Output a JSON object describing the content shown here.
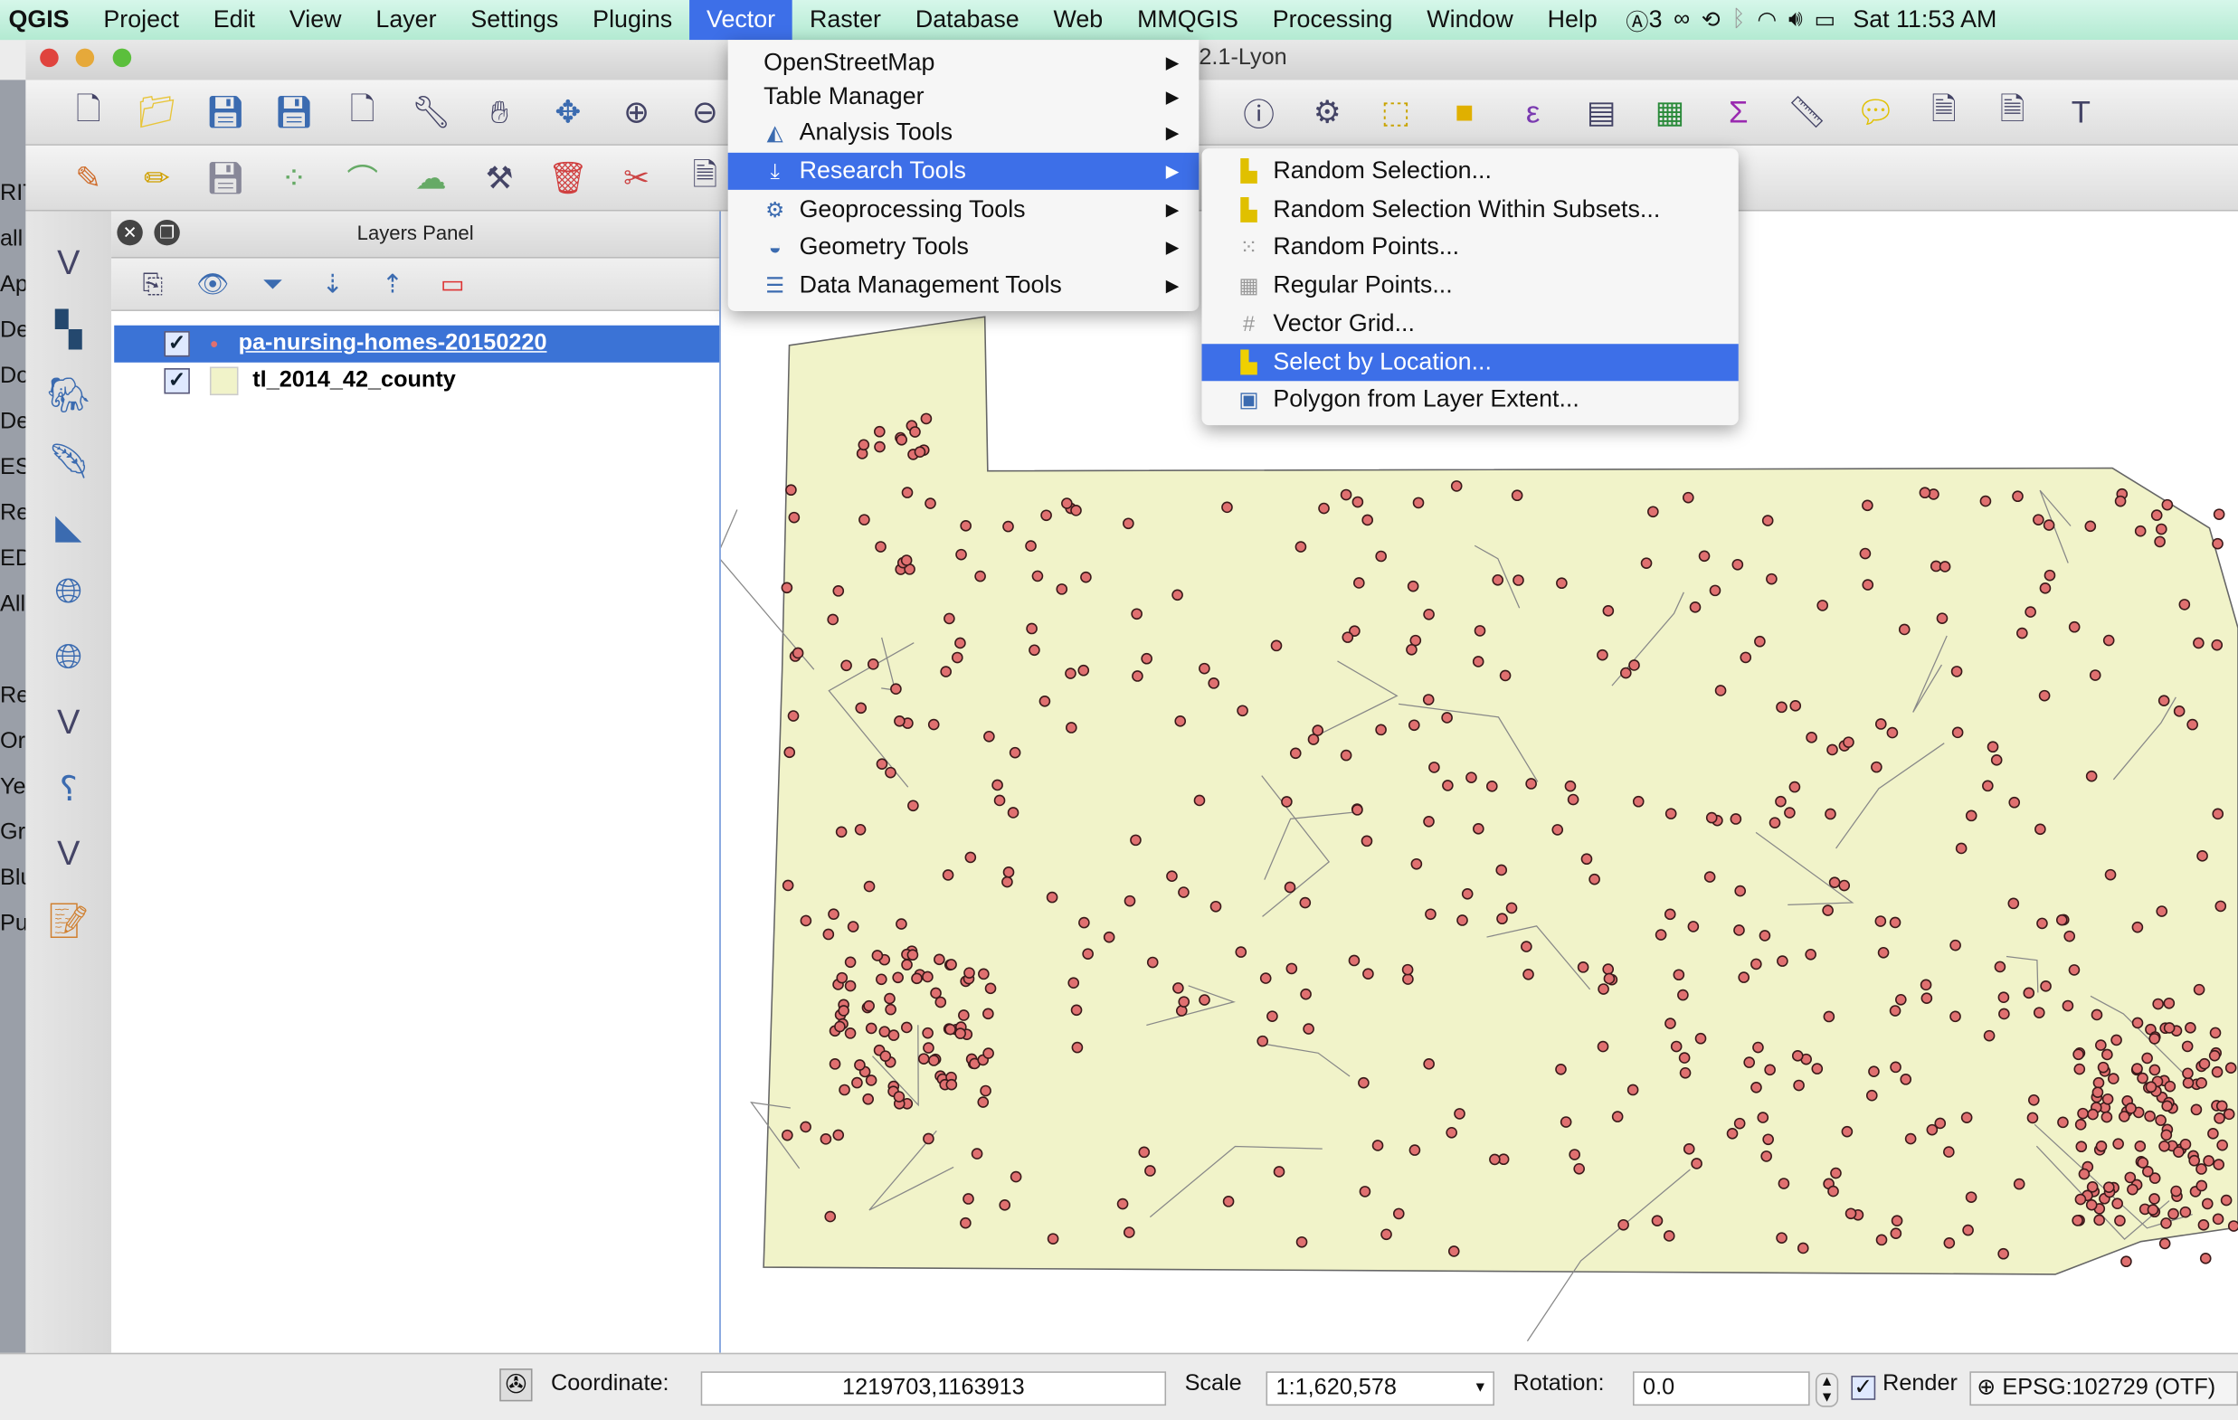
{
  "menubar": {
    "app": "QGIS",
    "items": [
      "Project",
      "Edit",
      "View",
      "Layer",
      "Settings",
      "Plugins",
      "Vector",
      "Raster",
      "Database",
      "Web",
      "MMQGIS",
      "Processing",
      "Window",
      "Help"
    ],
    "active": "Vector",
    "tray": {
      "adobe": "3",
      "clock": "Sat 11:53 AM"
    }
  },
  "window": {
    "title": "2.1-Lyon"
  },
  "left_stub": [
    "",
    "",
    "RIT",
    "all",
    "Ap",
    "De",
    "Do",
    "De",
    "ES",
    "Re",
    "ED",
    "All",
    "",
    "Re",
    "Or",
    "Ye",
    "Gr",
    "Blu",
    "Pu"
  ],
  "layers_panel": {
    "title": "Layers Panel",
    "layers": [
      {
        "name": "pa-nursing-homes-20150220",
        "checked": true,
        "selected": true,
        "symbol": "point"
      },
      {
        "name": "tl_2014_42_county",
        "checked": true,
        "selected": false,
        "symbol": "polygon",
        "color": "#f1f3c9"
      }
    ]
  },
  "vector_menu": {
    "items": [
      {
        "label": "OpenStreetMap",
        "icon": "none"
      },
      {
        "label": "Table Manager",
        "icon": "none"
      },
      {
        "label": "Analysis Tools",
        "icon": "analysis-icon"
      },
      {
        "label": "Research Tools",
        "icon": "research-icon",
        "highlighted": true
      },
      {
        "label": "Geoprocessing Tools",
        "icon": "gear-icon"
      },
      {
        "label": "Geometry Tools",
        "icon": "geometry-icon"
      },
      {
        "label": "Data Management Tools",
        "icon": "data-icon"
      }
    ]
  },
  "research_submenu": {
    "items": [
      {
        "label": "Random Selection..."
      },
      {
        "label": "Random Selection Within Subsets..."
      },
      {
        "label": "Random Points..."
      },
      {
        "label": "Regular Points..."
      },
      {
        "label": "Vector Grid..."
      },
      {
        "label": "Select by Location...",
        "highlighted": true
      },
      {
        "label": "Polygon from Layer Extent..."
      }
    ]
  },
  "statusbar": {
    "coordinate_label": "Coordinate:",
    "coordinate": "1219703,1163913",
    "scale_label": "Scale",
    "scale": "1:1,620,578",
    "rotation_label": "Rotation:",
    "rotation": "0.0",
    "render_label": "Render",
    "render_checked": true,
    "crs": "EPSG:102729 (OTF)"
  },
  "colors": {
    "accent": "#3d6fe8",
    "county_fill": "#f1f3c9",
    "point_fill": "#e07070"
  }
}
